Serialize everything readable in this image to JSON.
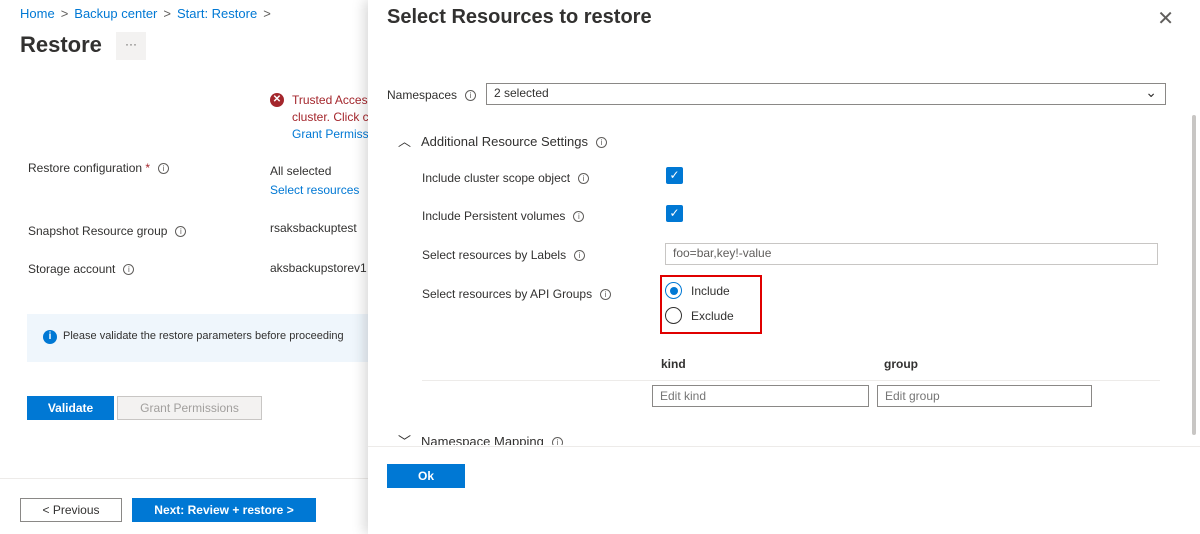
{
  "breadcrumb": [
    "Home",
    "Backup center",
    "Start: Restore"
  ],
  "page_title": "Restore",
  "more_label": "···",
  "error": {
    "line1": "Trusted Acces",
    "line2": "cluster. Click c",
    "link": "Grant Permiss"
  },
  "fields": {
    "restore_config": {
      "label": "Restore configuration",
      "required": "*",
      "value": "All selected",
      "link": "Select resources"
    },
    "snapshot_rg": {
      "label": "Snapshot Resource group",
      "value": "rsaksbackuptest"
    },
    "storage": {
      "label": "Storage account",
      "value": "aksbackupstorev1"
    }
  },
  "banner": "Please validate the restore parameters before proceeding",
  "buttons": {
    "validate": "Validate",
    "grant": "Grant Permissions",
    "previous": "< Previous",
    "next": "Next: Review + restore >"
  },
  "panel": {
    "title": "Select Resources to restore",
    "namespaces": {
      "label": "Namespaces",
      "value": "2 selected"
    },
    "additional": {
      "label": "Additional Resource Settings"
    },
    "cluster_scope": {
      "label": "Include cluster scope object",
      "checked": true
    },
    "persistent": {
      "label": "Include Persistent volumes",
      "checked": true
    },
    "labels": {
      "label": "Select resources by Labels",
      "value": "foo=bar,key!-value"
    },
    "api_groups": {
      "label": "Select resources by API Groups",
      "options": [
        "Include",
        "Exclude"
      ],
      "selected": "Include"
    },
    "table": {
      "headers": [
        "kind",
        "group"
      ],
      "placeholders": [
        "Edit kind",
        "Edit group"
      ]
    },
    "ns_mapping": {
      "label": "Namespace Mapping"
    },
    "ok": "Ok"
  },
  "colors": {
    "accent": "#0078d4",
    "error": "#a4262c",
    "highlight": "#e00000"
  }
}
